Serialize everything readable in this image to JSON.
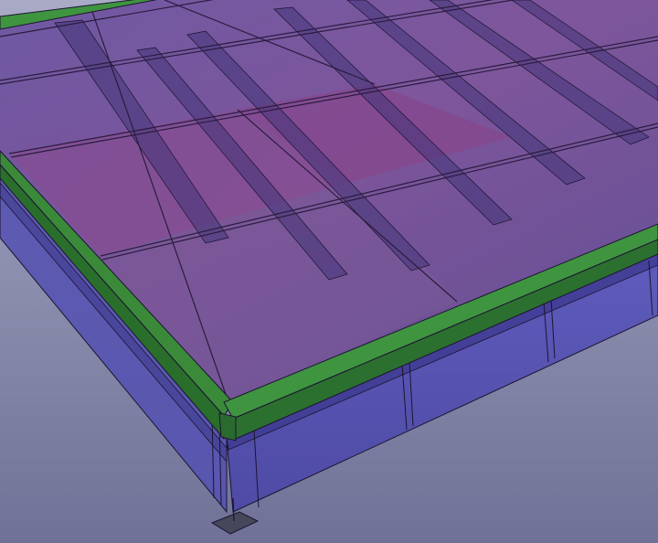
{
  "viewport": {
    "background_top": "#a9abc6",
    "background_bottom": "#6f7296"
  },
  "model": {
    "rim_color": "#2f6e2f",
    "rim_highlight": "#4a9a44",
    "rim_shadow": "#1f4d22",
    "deck_color_light": "#7a5a96",
    "deck_color_mid": "#6a4a8a",
    "deck_color_magenta": "#8a3f8a",
    "joist_color": "#4c3d86",
    "frame_color": "#5a55b8",
    "frame_shadow": "#4a45a0",
    "edge_color": "#1c1430",
    "support_color": "#4a4a5a"
  }
}
